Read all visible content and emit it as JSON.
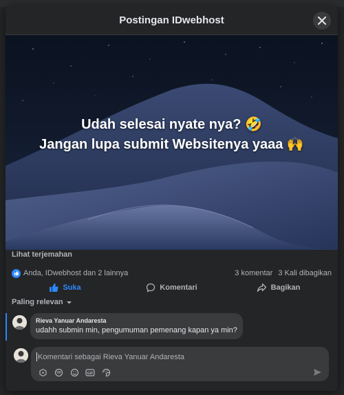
{
  "modal": {
    "title": "Postingan IDwebhost"
  },
  "post": {
    "overlay_line1": "Udah selesai nyate nya? 🤣",
    "overlay_line2": "Jangan lupa submit Websitenya yaaa 🙌",
    "translate_label": "Lihat terjemahan"
  },
  "stats": {
    "reactions": "Anda, IDwebhost dan 2 lainnya",
    "comments": "3 komentar",
    "shares": "3 Kali dibagikan"
  },
  "actions": {
    "like": "Suka",
    "comment": "Komentari",
    "share": "Bagikan"
  },
  "sort": {
    "label": "Paling relevan"
  },
  "comments": [
    {
      "author": "Rieva Yanuar Andaresta",
      "text": "udahh submin min, pengumuman pemenang kapan ya min?"
    }
  ],
  "composer": {
    "placeholder": "Komentari sebagai Rieva Yanuar Andaresta"
  },
  "colors": {
    "accent": "#2d88ff",
    "background": "#242526",
    "bubble": "#3a3b3c"
  },
  "icons": [
    "close-icon",
    "like-icon",
    "comment-icon",
    "share-icon",
    "chevron-down-icon",
    "sticker-icon",
    "avatar-sticker-icon",
    "emoji-icon",
    "gif-icon",
    "smiley-sticker-icon",
    "send-icon"
  ]
}
